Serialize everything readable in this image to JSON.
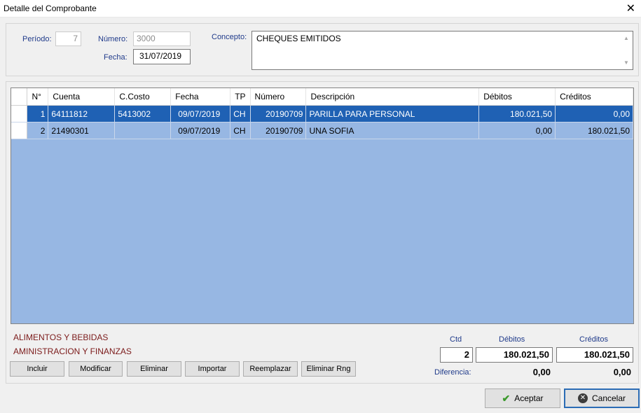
{
  "window": {
    "title": "Detalle del Comprobante"
  },
  "header": {
    "periodo_label": "Período:",
    "periodo_value": "7",
    "numero_label": "Número:",
    "numero_value": "3000",
    "fecha_label": "Fecha:",
    "fecha_value": "31/07/2019",
    "concepto_label": "Concepto:",
    "concepto_value": "CHEQUES EMITIDOS"
  },
  "grid": {
    "columns": [
      "N°",
      "Cuenta",
      "C.Costo",
      "Fecha",
      "TP",
      "Número",
      "Descripción",
      "Débitos",
      "Créditos"
    ],
    "rows": [
      {
        "n": "1",
        "cuenta": "64111812",
        "ccosto": "5413002",
        "fecha": "09/07/2019",
        "tp": "CH",
        "numero": "20190709",
        "descripcion": "PARILLA PARA PERSONAL",
        "debitos": "180.021,50",
        "creditos": "0,00"
      },
      {
        "n": "2",
        "cuenta": "21490301",
        "ccosto": "",
        "fecha": "09/07/2019",
        "tp": "CH",
        "numero": "20190709",
        "descripcion": "UNA SOFIA",
        "debitos": "0,00",
        "creditos": "180.021,50"
      }
    ]
  },
  "info": {
    "line1": "ALIMENTOS Y BEBIDAS",
    "line2": "AMINISTRACION Y FINANZAS"
  },
  "buttons": {
    "incluir": "Incluir",
    "modificar": "Modificar",
    "eliminar": "Eliminar",
    "importar": "Importar",
    "reemplazar": "Reemplazar",
    "eliminar_rng": "Eliminar Rng"
  },
  "totals": {
    "ctd_label": "Ctd",
    "debitos_label": "Débitos",
    "creditos_label": "Créditos",
    "ctd_value": "2",
    "debitos_value": "180.021,50",
    "creditos_value": "180.021,50",
    "diferencia_label": "Diferencia:",
    "diferencia_debitos": "0,00",
    "diferencia_creditos": "0,00"
  },
  "footer": {
    "aceptar": "Aceptar",
    "cancelar": "Cancelar"
  },
  "colors": {
    "selected_row": "#1f61b4",
    "grid_bg": "#97b7e3",
    "label_blue": "#1f3a8a",
    "info_red": "#7b1a1a"
  },
  "icons": {
    "close": "close-icon",
    "row_indicator": "row-pointer-icon",
    "accept": "check-icon",
    "cancel": "cancel-icon"
  }
}
